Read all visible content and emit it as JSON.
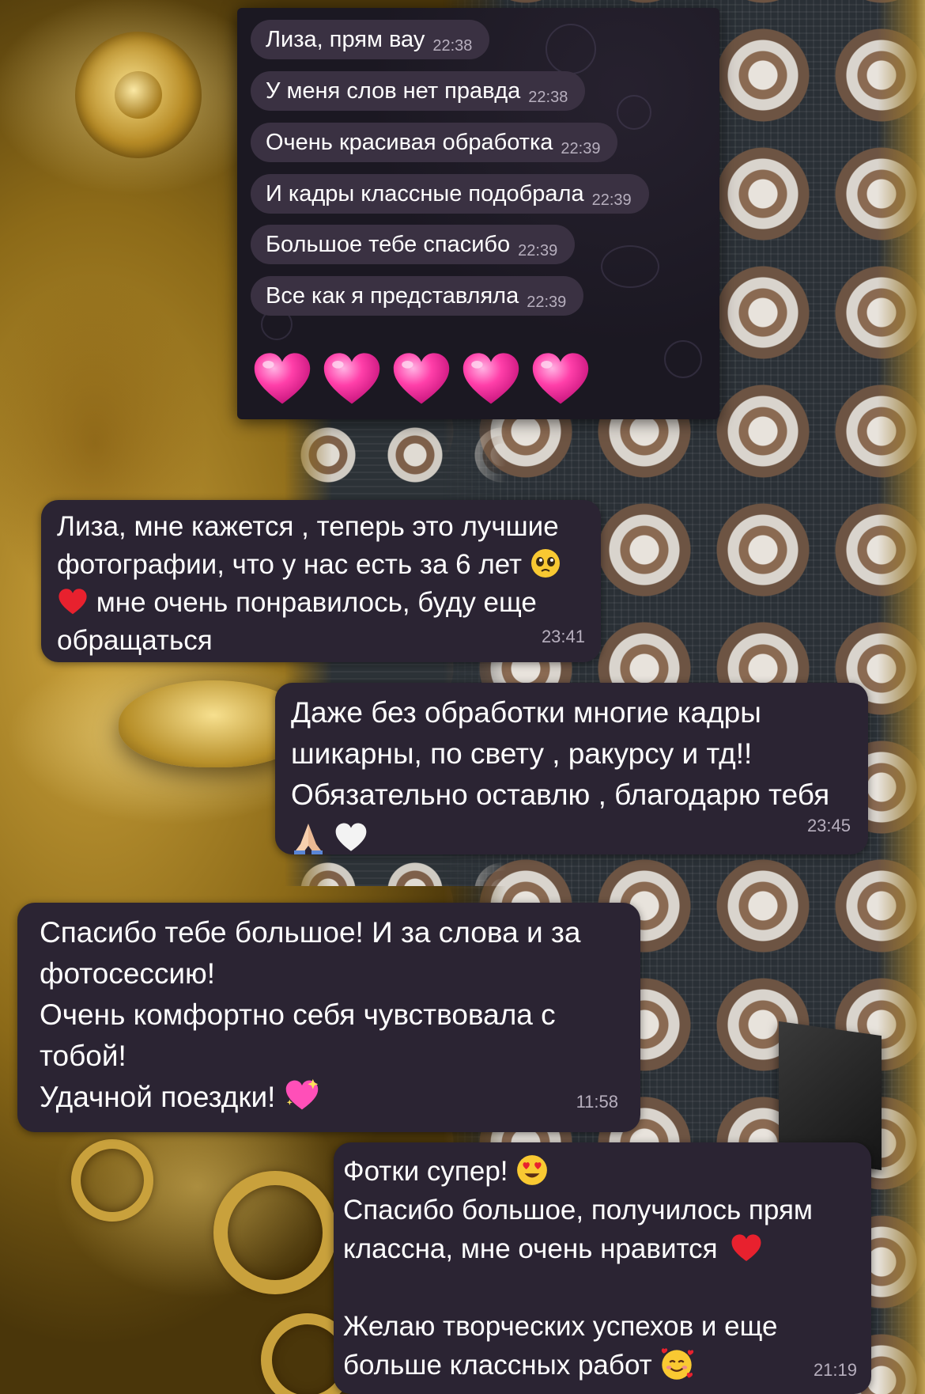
{
  "top_chat": {
    "messages": [
      {
        "text": "Лиза, прям вау",
        "time": "22:38"
      },
      {
        "text": "У меня слов нет правда",
        "time": "22:38"
      },
      {
        "text": "Очень красивая обработка",
        "time": "22:39"
      },
      {
        "text": "И кадры классные подобрала",
        "time": "22:39"
      },
      {
        "text": "Большое тебе спасибо",
        "time": "22:39"
      },
      {
        "text": "Все как я представляла",
        "time": "22:39"
      }
    ],
    "hearts": [
      "pink-heart-icon",
      "pink-heart-icon",
      "pink-heart-icon",
      "pink-heart-icon",
      "pink-heart-icon"
    ]
  },
  "messages": {
    "lisa": {
      "line1": "Лиза, мне кажется , теперь это лучшие",
      "line2": "фотографии, что у нас есть за 6 лет",
      "line3": "мне очень понравилось, буду еще",
      "line4": "обращаться",
      "time": "23:41",
      "emojis": [
        "pleading-face-icon",
        "red-heart-icon"
      ]
    },
    "dazhe": {
      "line1": "Даже без обработки многие кадры",
      "line2": "шикарны, по свету , ракурсу и тд!!",
      "line3": "Обязательно оставлю , благодарю тебя",
      "time": "23:45",
      "emojis": [
        "folded-hands-icon",
        "white-heart-icon"
      ]
    },
    "spasibo": {
      "line1": "Спасибо тебе большое! И за слова и за",
      "line2": "фотосессию!",
      "line3": "Очень комфортно себя чувствовала с",
      "line4": "тобой!",
      "line5": "Удачной поездки!",
      "time": "11:58",
      "emojis": [
        "sparkling-heart-icon"
      ]
    },
    "fotki": {
      "line1": "Фотки супер!",
      "line2": "Спасибо большое, получилось прям",
      "line3": "классна, мне очень нравится",
      "line4": "Желаю творческих успехов и еще",
      "line5": "больше классных работ",
      "time": "21:19",
      "emojis": [
        "heart-eyes-icon",
        "red-heart-icon",
        "smiling-hearts-icon"
      ]
    }
  },
  "colors": {
    "bubble": "#2b2433",
    "small_bubble": "#3a3142",
    "time_text": "#b7afbe",
    "heart_pink": "#ff3fa9",
    "red_heart": "#e8212e"
  }
}
